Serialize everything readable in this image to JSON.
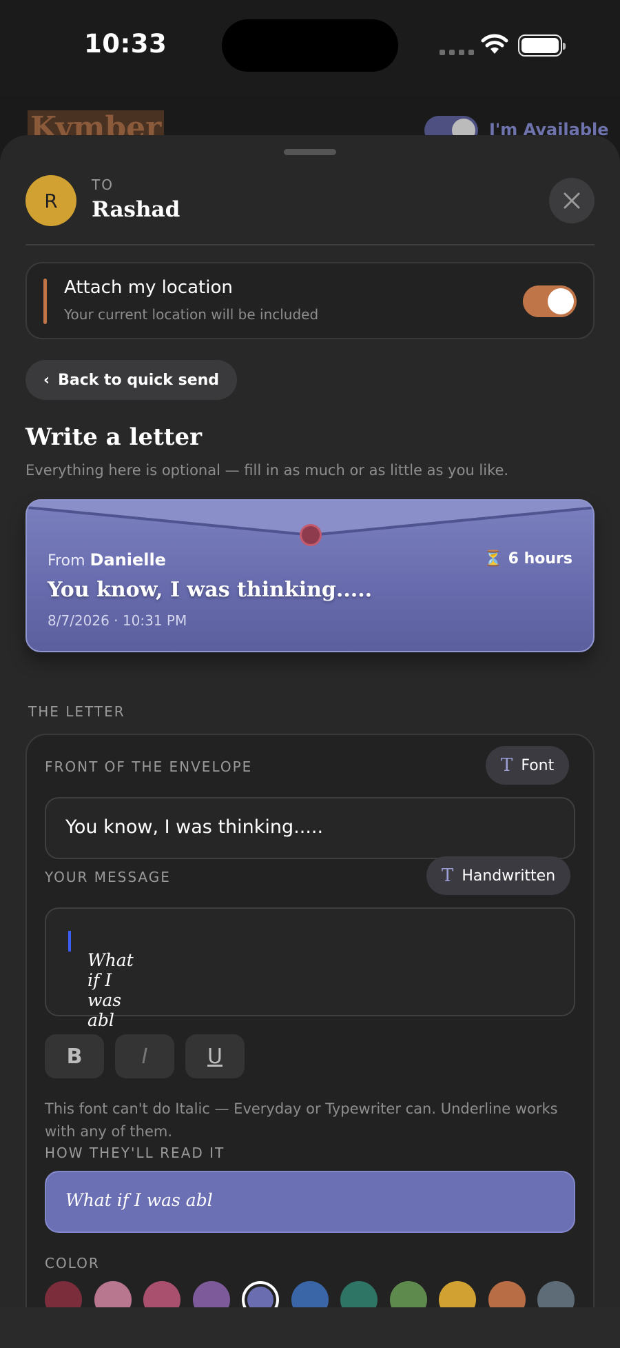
{
  "status": {
    "time": "10:33"
  },
  "app": {
    "title": "Kymber",
    "availability_label": "I'm Available"
  },
  "sheet": {
    "recipient_initial": "R",
    "to_label": "TO",
    "recipient_name": "Rashad",
    "location": {
      "title": "Attach my location",
      "subtitle": "Your current location will be included",
      "enabled": true
    },
    "back_label": "Back to quick send",
    "heading": "Write a letter",
    "subheading": "Everything here is optional — fill in as much or as little as you like.",
    "envelope": {
      "from_prefix": "From",
      "from_name": "Danielle",
      "timer": "6 hours",
      "subject": "You know, I was thinking.....",
      "date": "8/7/2026 · 10:31 PM"
    },
    "section_label": "THE LETTER",
    "front_label": "FRONT OF THE ENVELOPE",
    "font_button": "Font",
    "front_value": "You know, I was thinking.....",
    "message_label": "YOUR MESSAGE",
    "handwritten_button": "Handwritten",
    "message_value": "What if I was abl",
    "format_buttons": {
      "bold": "B",
      "italic": "I",
      "underline": "U"
    },
    "format_note": "This font can't do Italic — Everyday or Typewriter can. Underline works with any of them.",
    "preview_label": "HOW THEY'LL READ IT",
    "preview_value": "What if I was abl",
    "color_label": "COLOR",
    "colors": [
      "#7b2d3c",
      "#b8768f",
      "#a9506f",
      "#7d5a9a",
      "#6a6db0",
      "#3a66a8",
      "#2f7565",
      "#5e8a4e",
      "#d1a232",
      "#b86d45",
      "#5d6c76"
    ],
    "selected_color": "#6a6db0"
  }
}
